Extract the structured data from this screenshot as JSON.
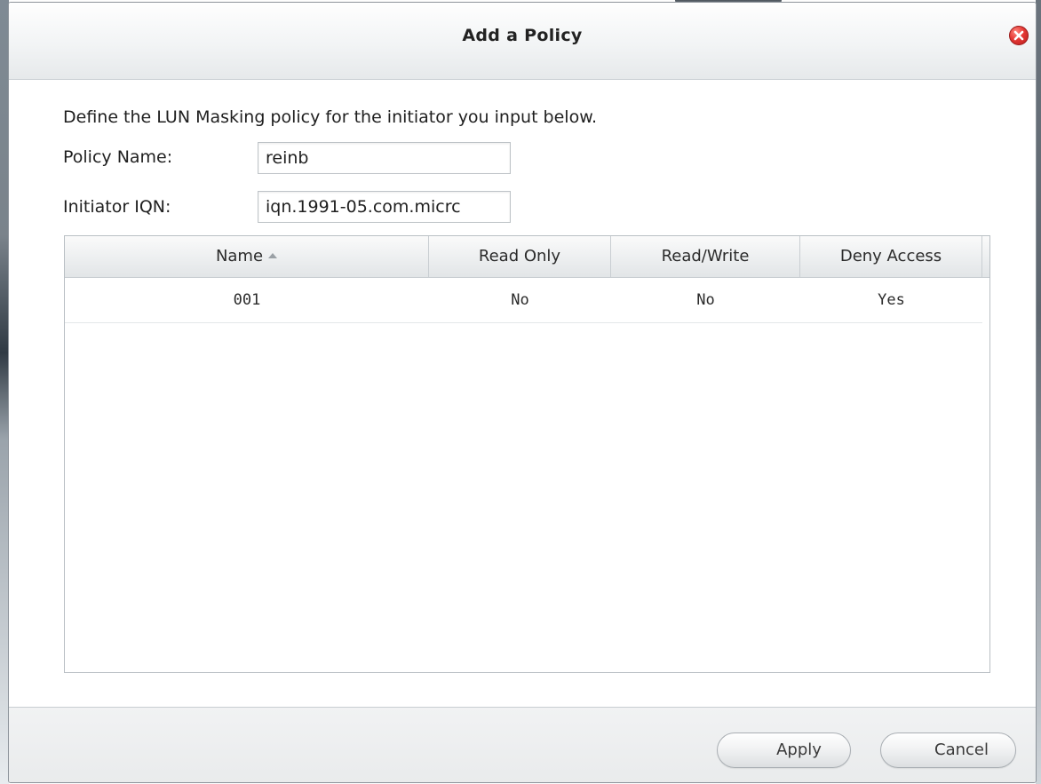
{
  "dialog": {
    "title": "Add a Policy",
    "description": "Define the LUN Masking policy for the initiator you input below.",
    "close_icon": "close-icon"
  },
  "form": {
    "policy_name_label": "Policy Name:",
    "policy_name_value": "reinb",
    "initiator_iqn_label": "Initiator IQN:",
    "initiator_iqn_value": "iqn.1991-05.com.micrc"
  },
  "table": {
    "columns": {
      "name": "Name",
      "read_only": "Read Only",
      "read_write": "Read/Write",
      "deny_access": "Deny Access"
    },
    "sort": {
      "column": "name",
      "direction": "ascending"
    },
    "rows": [
      {
        "name": "001",
        "read_only": "No",
        "read_write": "No",
        "deny_access": "Yes"
      }
    ]
  },
  "footer": {
    "apply_label": "Apply",
    "cancel_label": "Cancel"
  },
  "colors": {
    "close_button": "#e53935",
    "titlebar": "#eef0f1",
    "footer": "#ebedee"
  }
}
